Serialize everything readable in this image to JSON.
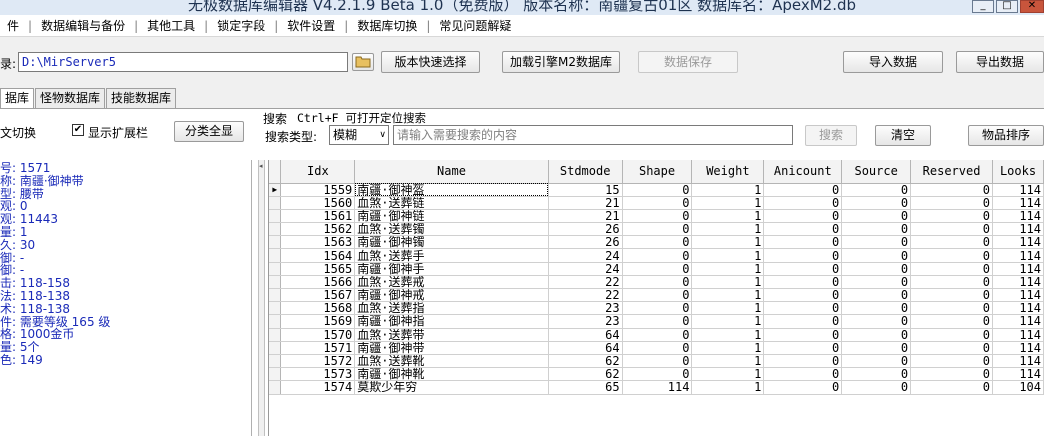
{
  "window": {
    "title": "无极数据库编辑器 V4.2.1.9   Beta 1.0（免费版）   版本名称：南疆复古01区   数据库名：ApexM2.db",
    "minimize_glyph": "_",
    "maximize_glyph": "□",
    "close_glyph": "✕"
  },
  "menu": [
    "件",
    "数据编辑与备份",
    "其他工具",
    "锁定字段",
    "软件设置",
    "数据库切换",
    "常见问题解疑"
  ],
  "path_row": {
    "label": "录:",
    "path_value": "D:\\MirServer5",
    "quick_select_label": "版本快速选择",
    "load_engine_label": "加载引擎M2数据库",
    "save_label": "数据保存",
    "import_label": "导入数据",
    "export_label": "导出数据"
  },
  "tabs": [
    "据库",
    "怪物数据库",
    "技能数据库"
  ],
  "options": {
    "text_switch_label": "文切换",
    "show_ext_label": "显示扩展栏",
    "show_ext_checked": true,
    "show_all_label": "分类全显"
  },
  "search": {
    "heading": "搜索",
    "hint": "Ctrl+F 可打开定位搜索",
    "type_label": "搜索类型:",
    "type_value": "模糊",
    "placeholder": "请输入需要搜索的内容",
    "search_label": "搜索",
    "clear_label": "清空",
    "sort_label": "物品排序"
  },
  "item_info": [
    "号: 1571",
    "称: 南疆·御神带",
    "型: 腰带",
    "观: 0",
    "观: 11443",
    "量: 1",
    "久: 30",
    "御: -",
    "御: -",
    "击: 118-158",
    "法: 118-138",
    "术: 118-138",
    "件: 需要等级 165 级",
    "格: 1000金币",
    "量: 5个",
    "色: 149"
  ],
  "table": {
    "columns": [
      "Idx",
      "Name",
      "Stdmode",
      "Shape",
      "Weight",
      "Anicount",
      "Source",
      "Reserved",
      "Looks"
    ],
    "rows": [
      [
        "1559",
        "南疆·御神盔",
        "15",
        "0",
        "1",
        "0",
        "0",
        "0",
        "114"
      ],
      [
        "1560",
        "血煞·送葬链",
        "21",
        "0",
        "1",
        "0",
        "0",
        "0",
        "114"
      ],
      [
        "1561",
        "南疆·御神链",
        "21",
        "0",
        "1",
        "0",
        "0",
        "0",
        "114"
      ],
      [
        "1562",
        "血煞·送葬镯",
        "26",
        "0",
        "1",
        "0",
        "0",
        "0",
        "114"
      ],
      [
        "1563",
        "南疆·御神镯",
        "26",
        "0",
        "1",
        "0",
        "0",
        "0",
        "114"
      ],
      [
        "1564",
        "血煞·送葬手",
        "24",
        "0",
        "1",
        "0",
        "0",
        "0",
        "114"
      ],
      [
        "1565",
        "南疆·御神手",
        "24",
        "0",
        "1",
        "0",
        "0",
        "0",
        "114"
      ],
      [
        "1566",
        "血煞·送葬戒",
        "22",
        "0",
        "1",
        "0",
        "0",
        "0",
        "114"
      ],
      [
        "1567",
        "南疆·御神戒",
        "22",
        "0",
        "1",
        "0",
        "0",
        "0",
        "114"
      ],
      [
        "1568",
        "血煞·送葬指",
        "23",
        "0",
        "1",
        "0",
        "0",
        "0",
        "114"
      ],
      [
        "1569",
        "南疆·御神指",
        "23",
        "0",
        "1",
        "0",
        "0",
        "0",
        "114"
      ],
      [
        "1570",
        "血煞·送葬带",
        "64",
        "0",
        "1",
        "0",
        "0",
        "0",
        "114"
      ],
      [
        "1571",
        "南疆·御神带",
        "64",
        "0",
        "1",
        "0",
        "0",
        "0",
        "114"
      ],
      [
        "1572",
        "血煞·送葬靴",
        "62",
        "0",
        "1",
        "0",
        "0",
        "0",
        "114"
      ],
      [
        "1573",
        "南疆·御神靴",
        "62",
        "0",
        "1",
        "0",
        "0",
        "0",
        "114"
      ],
      [
        "1574",
        "莫欺少年穷",
        "65",
        "114",
        "1",
        "0",
        "0",
        "0",
        "104"
      ]
    ]
  },
  "row_indicator_glyph": "▶",
  "scroll_glyph": "◂"
}
